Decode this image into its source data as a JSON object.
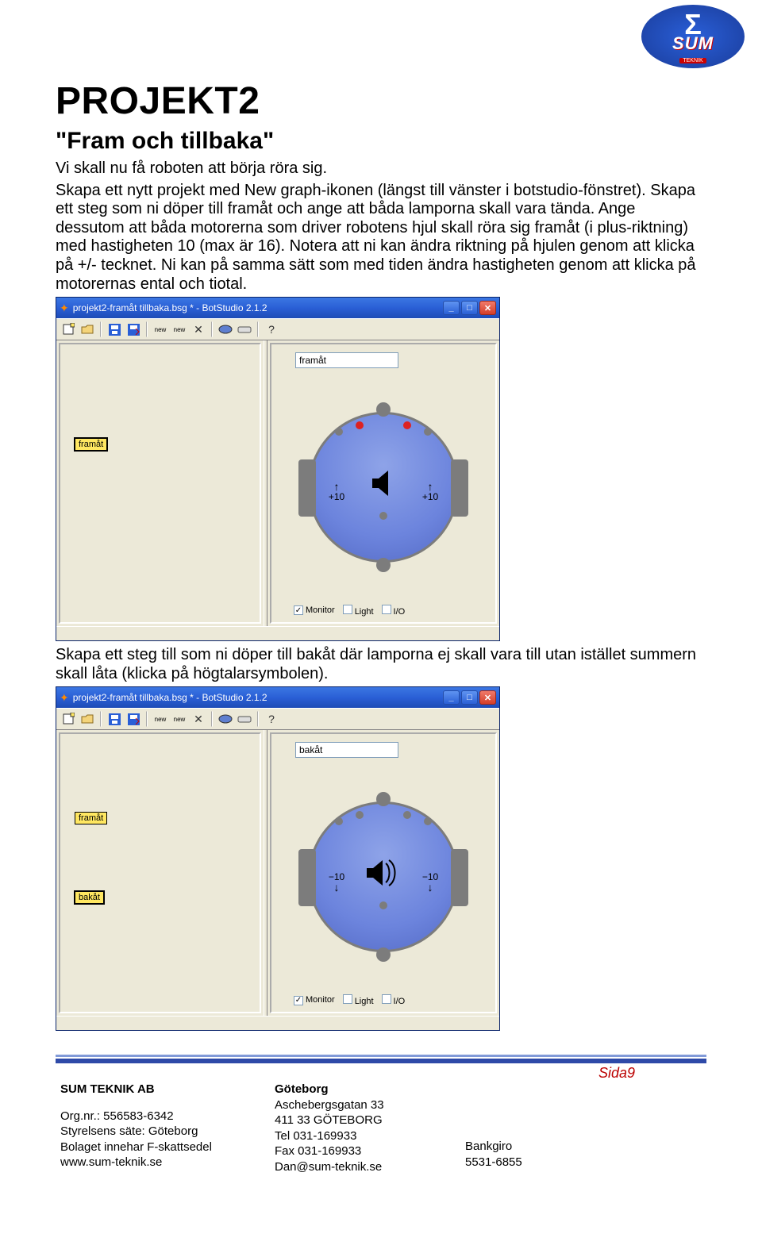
{
  "logo": {
    "top": "Σ",
    "name": "SUM",
    "sub": "TEKNIK"
  },
  "headline": "PROJEKT2",
  "subtitle": "\"Fram och tillbaka\"",
  "paragraph1": "Vi skall nu få roboten att börja röra sig.",
  "paragraph2": "Skapa ett nytt projekt med New graph-ikonen (längst till vänster i botstudio-fönstret). Skapa ett steg som ni döper till framåt och ange att båda lamporna skall vara tända. Ange dessutom att båda motorerna som driver robotens hjul skall röra sig framåt (i plus-riktning) med hastigheten 10 (max är 16). Notera att ni kan ändra riktning på hjulen genom att klicka på +/- tecknet. Ni kan på samma sätt som med tiden ändra hastigheten genom att klicka på motorernas ental och tiotal.",
  "paragraph3": "Skapa ett steg till som ni döper till bakåt där lamporna ej skall vara till utan istället summern skall låta (klicka på högtalarsymbolen).",
  "win": {
    "title": "projekt2-framåt tillbaka.bsg * - BotStudio 2.1.2",
    "checks": {
      "monitor": "Monitor",
      "light": "Light",
      "io": "I/O"
    }
  },
  "screenshot1": {
    "stateName": "framåt",
    "nodes": {
      "framat": "framåt"
    },
    "leds": "on",
    "motorL": {
      "sign": "+",
      "val": "10",
      "arrow": "↑"
    },
    "motorR": {
      "sign": "+",
      "val": "10",
      "arrow": "↑"
    },
    "speaker": "off"
  },
  "screenshot2": {
    "stateName": "bakåt",
    "nodes": {
      "framat": "framåt",
      "bakat": "bakåt"
    },
    "leds": "off",
    "motorL": {
      "sign": "−",
      "val": "10",
      "arrow": "↓"
    },
    "motorR": {
      "sign": "−",
      "val": "10",
      "arrow": "↓"
    },
    "speaker": "on"
  },
  "page_label": "Sida9",
  "footer": {
    "col1": {
      "l1": "SUM TEKNIK AB",
      "l2": "Org.nr.: 556583-6342",
      "l3": "Styrelsens säte: Göteborg",
      "l4": "Bolaget innehar F-skattsedel",
      "l5": "www.sum-teknik.se"
    },
    "col2": {
      "l1": "Göteborg",
      "l2": "Aschebergsgatan 33",
      "l3": "411 33 GÖTEBORG",
      "l4": "Tel 031-169933",
      "l5": "Fax 031-169933",
      "l6": "Dan@sum-teknik.se"
    },
    "col3": {
      "l1": "Bankgiro",
      "l2": "5531-6855"
    }
  }
}
